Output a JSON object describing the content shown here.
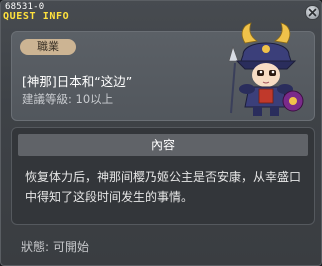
{
  "window": {
    "id_tag": "68531-0",
    "title": "QUEST INFO"
  },
  "npc": {
    "job_label": "職業",
    "name": "[神那]日本和“这边”",
    "level": "建議等級: 10以上"
  },
  "content": {
    "header": "內容",
    "description": "恢复体力后，神那间樱乃姬公主是否安康，从幸盛口中得知了这段时间发生的事情。"
  },
  "status": {
    "label": "狀態:",
    "value": "可開始"
  },
  "icons": {
    "close": "close-icon",
    "avatar": "samurai-npc-avatar"
  },
  "colors": {
    "title": "#ffe23d",
    "badge": "#ccb493"
  }
}
